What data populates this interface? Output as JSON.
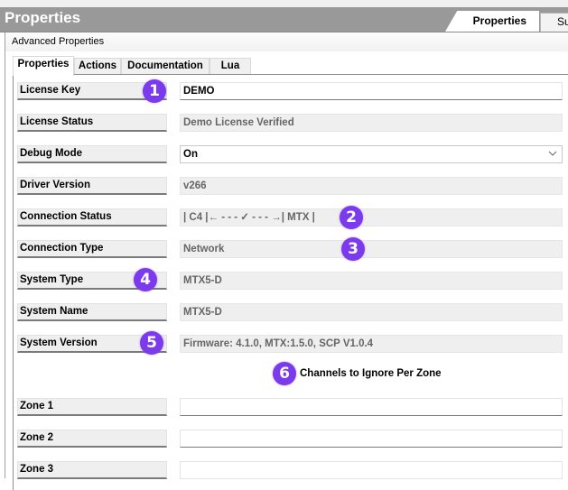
{
  "window": {
    "title": "Properties",
    "top_tabs": [
      {
        "label": "Properties",
        "active": true
      },
      {
        "label": "Su",
        "active": false
      }
    ]
  },
  "advanced_bar": {
    "label": "Advanced Properties"
  },
  "inner_tabs": [
    {
      "label": "Properties",
      "active": true
    },
    {
      "label": "Actions",
      "active": false
    },
    {
      "label": "Documentation",
      "active": false
    },
    {
      "label": "Lua",
      "active": false
    }
  ],
  "properties": [
    {
      "label": "License Key",
      "value": "DEMO",
      "kind": "input"
    },
    {
      "label": "License Status",
      "value": "Demo License Verified",
      "kind": "readonly"
    },
    {
      "label": "Debug Mode",
      "value": "On",
      "kind": "select"
    },
    {
      "label": "Driver Version",
      "value": "v266",
      "kind": "readonly"
    },
    {
      "label": "Connection Status",
      "value": "| C4 |← - - - ✓ - - - →| MTX |",
      "kind": "readonly"
    },
    {
      "label": "Connection Type",
      "value": "Network",
      "kind": "readonly"
    },
    {
      "label": "System Type",
      "value": "MTX5-D",
      "kind": "readonly"
    },
    {
      "label": "System Name",
      "value": "MTX5-D",
      "kind": "readonly"
    },
    {
      "label": "System Version",
      "value": "Firmware: 4.1.0, MTX:1.5.0, SCP V1.0.4",
      "kind": "readonly"
    }
  ],
  "section": {
    "title": "Channels to Ignore Per Zone"
  },
  "zones": [
    {
      "label": "Zone 1",
      "value": ""
    },
    {
      "label": "Zone 2",
      "value": ""
    },
    {
      "label": "Zone 3",
      "value": ""
    }
  ],
  "annotations": [
    "1",
    "2",
    "3",
    "4",
    "5",
    "6"
  ],
  "colors": {
    "badge": "#7c3aed",
    "titlebar": "#999999"
  }
}
